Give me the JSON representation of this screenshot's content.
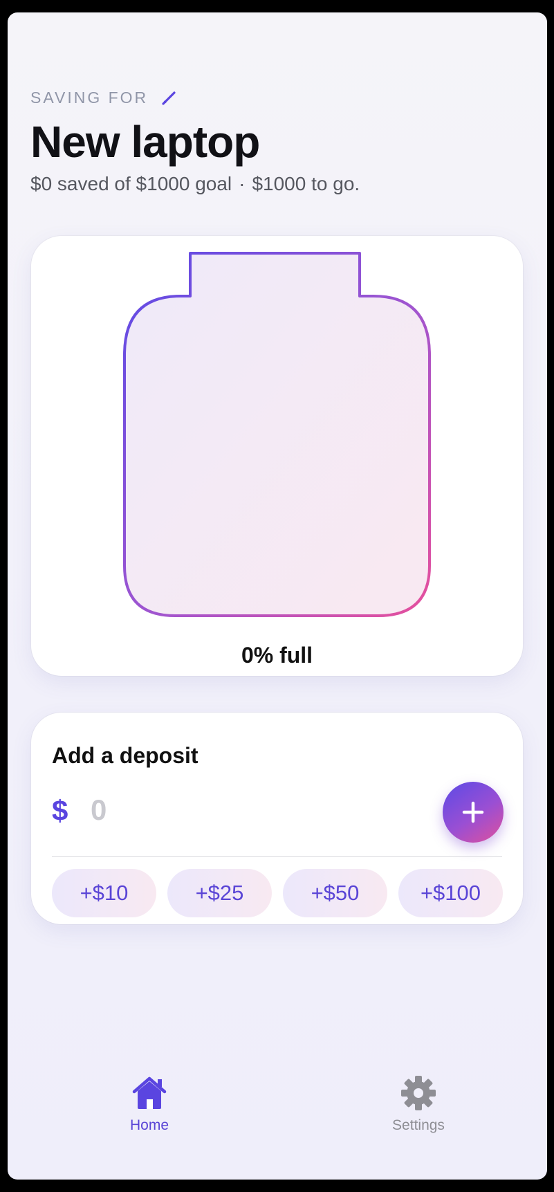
{
  "header": {
    "eyebrow": "SAVING FOR",
    "goal_name": "New laptop",
    "saved": "$0 saved of $1000 goal",
    "separator": "·",
    "to_go": "$1000 to go."
  },
  "jar": {
    "fill_fraction": 0,
    "fill_label": "0% full"
  },
  "deposit": {
    "title": "Add a deposit",
    "currency_symbol": "$",
    "amount_value": "",
    "amount_placeholder": "0",
    "quick_amounts": [
      "+$10",
      "+$25",
      "+$50",
      "+$100"
    ]
  },
  "tabbar": {
    "items": [
      {
        "label": "Home",
        "icon": "home-icon",
        "active": true
      },
      {
        "label": "Settings",
        "icon": "gear-icon",
        "active": false
      }
    ]
  },
  "colors": {
    "accent": "#5a45e0",
    "accent_end": "#e0509c",
    "inactive": "#8e8e94"
  }
}
